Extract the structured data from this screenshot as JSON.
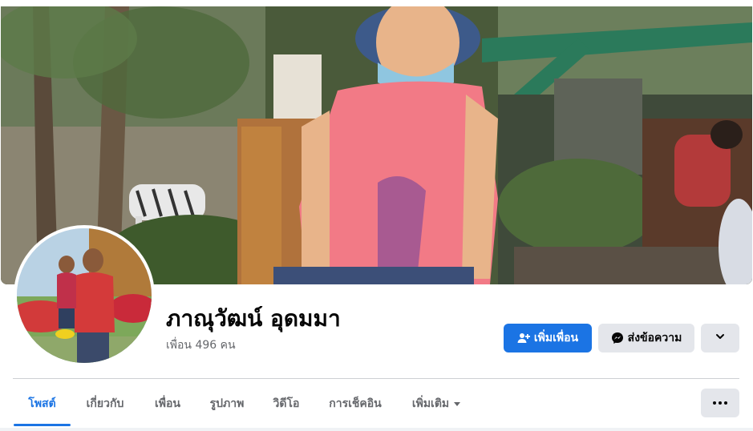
{
  "profile": {
    "name": "ภาณุวัฒน์ อุดมมา",
    "friends_text": "เพื่อน 496 คน"
  },
  "actions": {
    "add_friend_label": "เพิ่มเพื่อน",
    "message_label": "ส่งข้อความ",
    "more_icon": "chevron-down-icon"
  },
  "tabs": [
    {
      "label": "โพสต์",
      "active": true
    },
    {
      "label": "เกี่ยวกับ",
      "active": false
    },
    {
      "label": "เพื่อน",
      "active": false
    },
    {
      "label": "รูปภาพ",
      "active": false
    },
    {
      "label": "วิดีโอ",
      "active": false
    },
    {
      "label": "การเช็คอิน",
      "active": false
    },
    {
      "label": "เพิ่มเติม",
      "active": false,
      "has_dropdown": true
    }
  ],
  "colors": {
    "accent": "#1b74e4",
    "secondary_button": "#e4e6eb",
    "muted_text": "#65676b"
  }
}
